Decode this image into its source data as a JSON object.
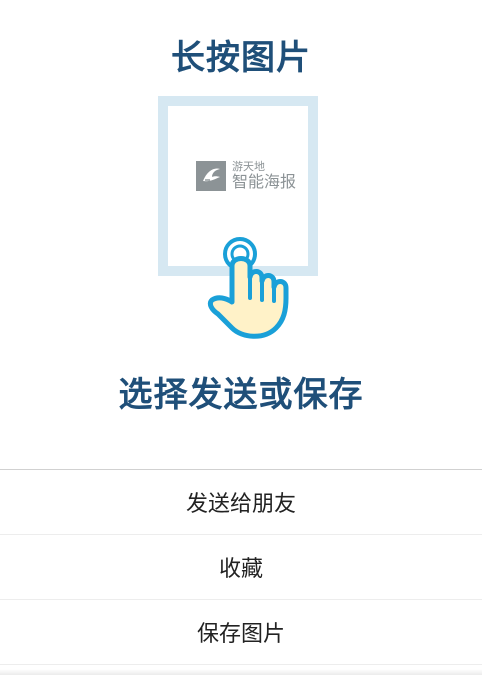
{
  "titles": {
    "top": "长按图片",
    "bottom": "选择发送或保存"
  },
  "preview": {
    "logo_small": "游天地",
    "logo_big": "智能海报",
    "icon_name": "shark-logo-icon"
  },
  "gesture": {
    "icon_name": "tap-hand-icon"
  },
  "sheet": {
    "items": [
      "发送给朋友",
      "收藏",
      "保存图片"
    ]
  },
  "colors": {
    "title": "#1f4f79",
    "frame": "#d6e8f2",
    "hand_fill": "#fff2c8",
    "hand_outline": "#1aa0d8"
  }
}
